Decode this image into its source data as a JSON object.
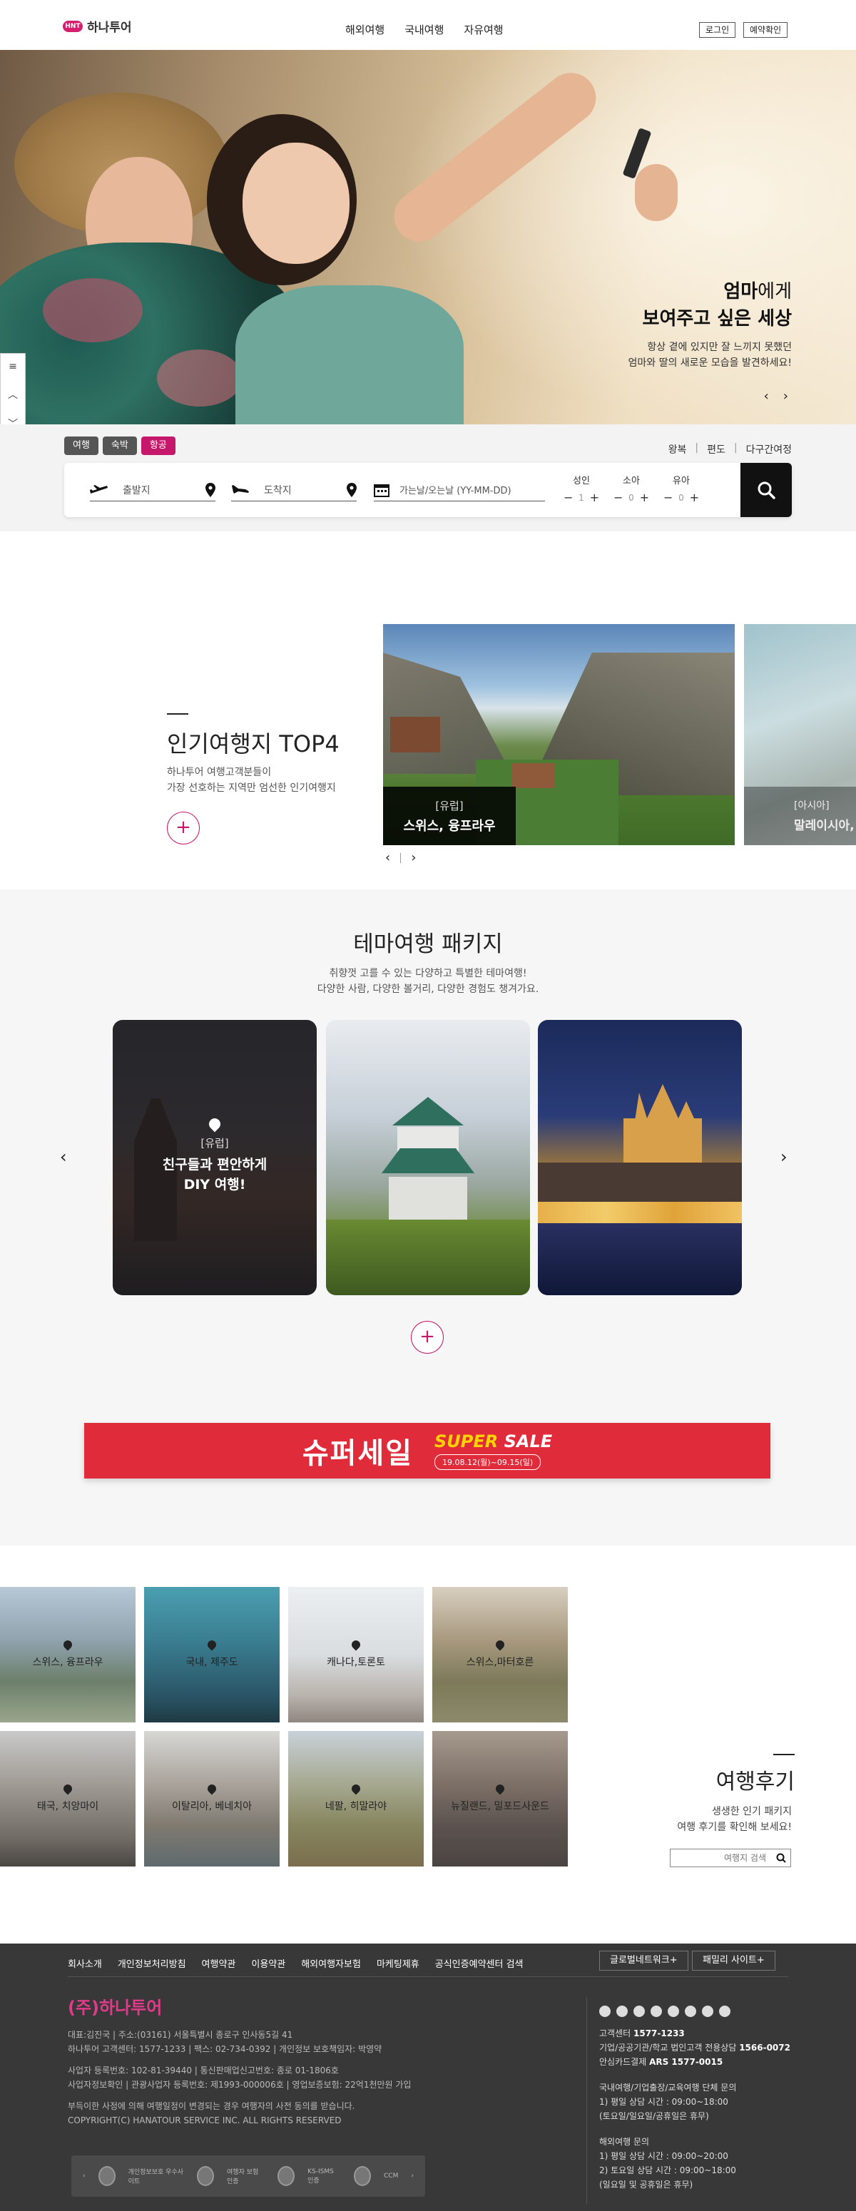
{
  "header": {
    "logo_badge": "HNT",
    "logo_text": "하나투어",
    "nav": [
      "해외여행",
      "국내여행",
      "자유여행"
    ],
    "login": "로그인",
    "reservation": "예약확인"
  },
  "hero": {
    "title_bold": "엄마",
    "title_rest": "에게",
    "title_line2": "보여주고 싶은 세상",
    "sub_line1": "항상 곁에 있지만 잘 느끼지 못했던",
    "sub_line2": "엄마와 딸의 새로운 모습을 발견하세요!",
    "prev": "‹",
    "next": "›"
  },
  "side_nav": [
    "≡",
    "︿",
    "﹀"
  ],
  "search": {
    "tabs": [
      "여행",
      "숙박",
      "항공"
    ],
    "active_tab": "항공",
    "trip_types": [
      "왕복",
      "편도",
      "다구간여정"
    ],
    "depart_placeholder": "출발지",
    "arrive_placeholder": "도착지",
    "date_placeholder": "가는날/오는날 (YY-MM-DD)",
    "pax": [
      {
        "label": "성인",
        "value": "1"
      },
      {
        "label": "소아",
        "value": "0"
      },
      {
        "label": "유아",
        "value": "0"
      }
    ],
    "minus": "−",
    "plus": "+"
  },
  "top4": {
    "title": "인기여행지 TOP4",
    "sub_line1": "하나투어 여행고객분들이",
    "sub_line2": "가장 선호하는 지역만 엄선한 인기여행지",
    "more": "+",
    "cards": [
      {
        "region": "[유럽]",
        "place": "스위스, 융프라우"
      },
      {
        "region": "[아시아]",
        "place": "말레이시아, 코타키나발루"
      }
    ],
    "prev": "‹",
    "next": "›"
  },
  "theme": {
    "title": "테마여행 패키지",
    "sub_line1": "취향껏 고를 수 있는 다양하고 특별한 테마여행!",
    "sub_line2": "다양한 사람, 다양한 볼거리, 다양한 경험도 챙겨가요.",
    "card1_region": "[유럽]",
    "card1_line1": "친구들과 편안하게",
    "card1_line2": "DIY 여행!",
    "prev": "‹",
    "next": "›",
    "more": "+"
  },
  "sale": {
    "korean": "슈퍼세일",
    "english_super": "SUPER",
    "english_sale": "SALE",
    "dates": "19.08.12(월)~09.15(일)"
  },
  "reviews": {
    "title": "여행후기",
    "sub_line1": "생생한 인기 패키지",
    "sub_line2": "여행 후기를 확인해 보세요!",
    "search_placeholder": "여행지 검색",
    "items": [
      "스위스, 융프라우",
      "국내, 제주도",
      "캐나다,토론토",
      "스위스,마터호른",
      "태국, 치앙마이",
      "이탈리아, 베네치아",
      "네팔, 히말라야",
      "뉴질랜드, 밀포드사운드"
    ]
  },
  "footer": {
    "links": [
      "회사소개",
      "개인정보처리방침",
      "여행약관",
      "이용약관",
      "해외여행자보험",
      "마케팅제휴",
      "공식인증예약센터 검색"
    ],
    "global_btn": "글로벌네트워크+",
    "family_btn": "패밀리 사이트+",
    "company": "(주)하나투어",
    "info_lines": [
      "대표:김진국 | 주소:(03161) 서울특별시 종로구 인사동5길 41",
      "하나투어 고객센터: 1577-1233 | 팩스: 02-734-0392 | 개인정보 보호책임자: 박영약",
      "",
      "사업자 등록번호: 102-81-39440 | 통신판매업신고번호: 종로 01-1806호",
      "사업자정보확인 | 관광사업자 등록번호: 제1993-000006호 | 영업보증보험: 22억1천만원 가입",
      "",
      "부득이한 사정에 의해 여행일정이 변경되는 경우 여행자의 사전 동의를 받습니다.",
      "COPYRIGHT(C) HANATOUR SERVICE INC. ALL RIGHTS RESERVED"
    ],
    "cs_label": "고객센터",
    "cs_number": "1577-1233",
    "corp_label": "기업/공공기관/학교 법인고객 전용상담",
    "corp_number": "1566-0072",
    "card_label": "안심카드결제",
    "card_number": "ARS 1577-0015",
    "domestic_title": "국내여행/기업출장/교육여행 단체 문의",
    "domestic_lines": [
      "1) 평일 상담 시간 : 09:00~18:00",
      "(토요일/일요일/공휴일은 휴무)"
    ],
    "overseas_title": "해외여행 문의",
    "overseas_lines": [
      "1) 평일 상담 시간 : 09:00~20:00",
      "2) 토요일 상담 시간 : 09:00~18:00",
      "(일요일 및 공휴일은 휴무)"
    ],
    "certs": [
      "개인정보보호 우수사이트",
      "여행자 보험 인증",
      "KS-ISMS 인증",
      "CCM"
    ]
  }
}
